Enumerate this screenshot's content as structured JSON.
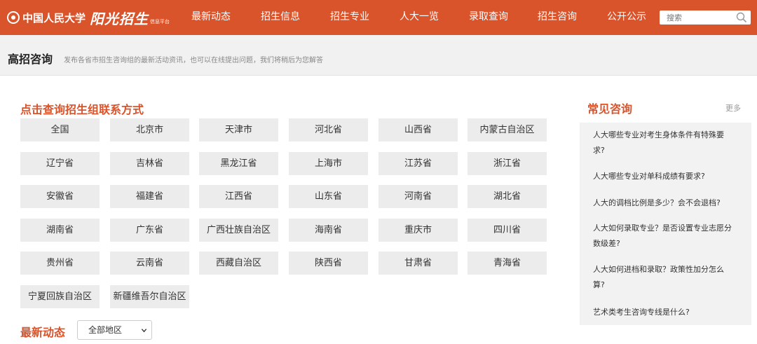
{
  "logo": {
    "university": "中国人民大学",
    "brand": "阳光招生",
    "sub": "信息平台"
  },
  "nav": [
    "最新动态",
    "招生信息",
    "招生专业",
    "人大一览",
    "录取查询",
    "招生咨询",
    "公开公示"
  ],
  "search": {
    "placeholder": "搜索",
    "icon": "search-icon"
  },
  "header": {
    "title": "高招咨询",
    "description": "发布各省市招生咨询组的最新活动资讯，也可以在线提出问题，我们将稍后为您解答"
  },
  "contact": {
    "title": "点击查询招生组联系方式",
    "regions": [
      "全国",
      "北京市",
      "天津市",
      "河北省",
      "山西省",
      "内蒙古自治区",
      "辽宁省",
      "吉林省",
      "黑龙江省",
      "上海市",
      "江苏省",
      "浙江省",
      "安徽省",
      "福建省",
      "江西省",
      "山东省",
      "河南省",
      "湖北省",
      "湖南省",
      "广东省",
      "广西壮族自治区",
      "海南省",
      "重庆市",
      "四川省",
      "贵州省",
      "云南省",
      "西藏自治区",
      "陕西省",
      "甘肃省",
      "青海省",
      "宁夏回族自治区",
      "新疆维吾尔自治区"
    ]
  },
  "news": {
    "title": "最新动态",
    "filter_value": "全部地区"
  },
  "faq": {
    "title": "常见咨询",
    "more": "更多",
    "items": [
      "人大哪些专业对考生身体条件有特殊要求?",
      "人大哪些专业对单科成绩有要求?",
      "人大的调档比例是多少？会不会退档?",
      "人大如何录取专业？是否设置专业志愿分数级差?",
      "人大如何进档和录取？政策性加分怎么算?",
      "艺术类考生咨询专线是什么?"
    ]
  },
  "colors": {
    "accent": "#d9532b",
    "tile": "#ececec",
    "faq_bg": "#f2f2f2"
  }
}
